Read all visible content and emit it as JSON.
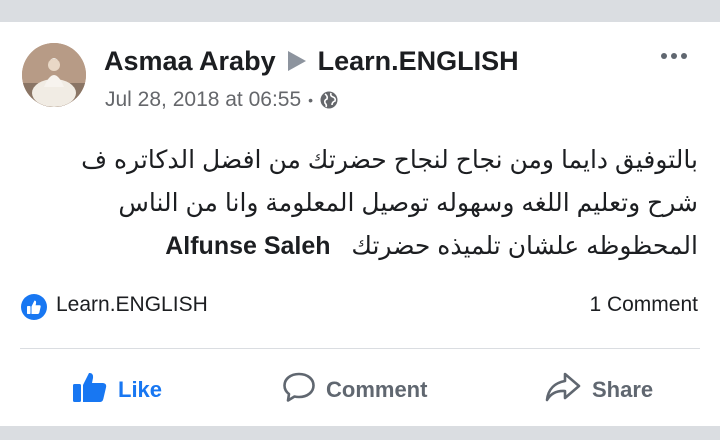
{
  "post": {
    "author": "Asmaa Araby",
    "group": "Learn.ENGLISH",
    "timestamp": "Jul 28, 2018 at 06:55",
    "separator": "•",
    "privacy_icon": "globe-icon",
    "menu_icon": "more-options-icon",
    "text_lines": [
      "بالتوفيق دايما ومن نجاح لنجاح حضرتك من افضل الدكاتره ف",
      "شرح وتعليم اللغه وسهوله توصيل المعلومة وانا من الناس",
      "المحظوظه علشان تلميذه حضرتك"
    ],
    "mention": "Alfunse Saleh"
  },
  "reactions": {
    "icon": "like-icon",
    "name": "Learn.ENGLISH",
    "comment_count": "1 Comment"
  },
  "actions": {
    "like": "Like",
    "comment": "Comment",
    "share": "Share"
  },
  "colors": {
    "brand": "#1877f2",
    "text": "#1c1e21",
    "muted": "#65676b",
    "page_bg": "#dadde1"
  }
}
